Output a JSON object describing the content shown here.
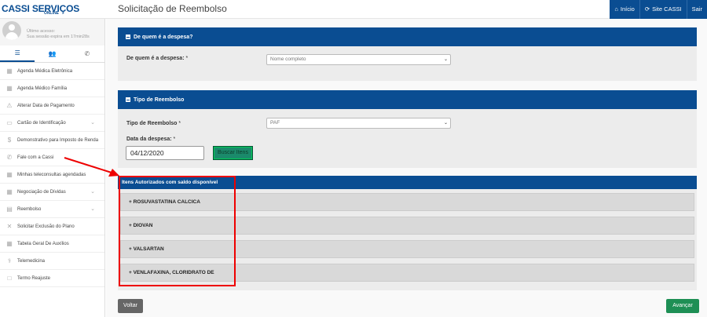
{
  "brand": {
    "name_cassi": "CASSI",
    "name_servicos": "SERVIÇOS",
    "name_online": "ONLINE"
  },
  "header": {
    "title": "Solicitação de Reembolso"
  },
  "topnav": {
    "inicio": "Início",
    "site_cassi": "Site CASSI",
    "sair": "Sair"
  },
  "profile": {
    "last_access": "Último acesso:",
    "session": "Sua sessão expira em 17min28s"
  },
  "sidebar": {
    "items": [
      {
        "label": "Agenda Médica Eletrônica",
        "icon": "calendar-icon",
        "chevron": false
      },
      {
        "label": "Agenda Médico Família",
        "icon": "calendar-icon",
        "chevron": false
      },
      {
        "label": "Alterar Data de Pagamento",
        "icon": "warning-icon",
        "chevron": false
      },
      {
        "label": "Cartão de Identificação",
        "icon": "card-icon",
        "chevron": true
      },
      {
        "label": "Demonstrativo para Imposto de Renda",
        "icon": "dollar-icon",
        "chevron": false
      },
      {
        "label": "Fale com a Cassi",
        "icon": "phone-icon",
        "chevron": false
      },
      {
        "label": "Minhas teleconsultas agendadas",
        "icon": "calendar-icon",
        "chevron": false
      },
      {
        "label": "Negociação de Dívidas",
        "icon": "calendar-icon",
        "chevron": true
      },
      {
        "label": "Reembolso",
        "icon": "money-icon",
        "chevron": true
      },
      {
        "label": "Solicitar Exclusão do Plano",
        "icon": "close-icon",
        "chevron": false
      },
      {
        "label": "Tabela Geral De Auxílios",
        "icon": "table-icon",
        "chevron": false
      },
      {
        "label": "Telemedicina",
        "icon": "stethoscope-icon",
        "chevron": false
      },
      {
        "label": "Termo Reajuste",
        "icon": "document-icon",
        "chevron": false
      }
    ]
  },
  "section1": {
    "title": "De quem é a despesa?",
    "field_label": "De quem é a despesa:",
    "required_mark": "*",
    "select_value": "Nome completo"
  },
  "section2": {
    "title": "Tipo de Reembolso",
    "type_label": "Tipo de Reembolso",
    "required_mark": "*",
    "type_value": "PAF",
    "date_label": "Data da despesa:",
    "date_value": "04/12/2020",
    "search_button": "Buscar Itens"
  },
  "items": {
    "title": "Itens Autorizados com saldo disponível",
    "list": [
      "+ ROSUVASTATINA CALCICA",
      "+ DIOVAN",
      "+ VALSARTAN",
      "+ VENLAFAXINA, CLORIDRATO DE"
    ]
  },
  "footer": {
    "back": "Voltar",
    "next": "Avançar"
  },
  "colors": {
    "primary": "#0a4d92",
    "success": "#1e8f55",
    "highlight": "#ee0000"
  }
}
